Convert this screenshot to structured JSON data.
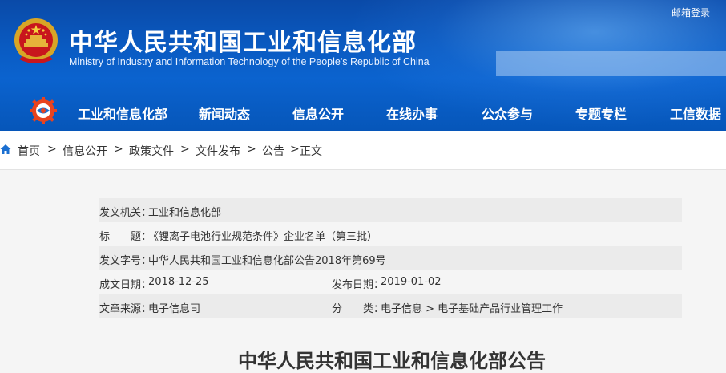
{
  "header": {
    "site_title": "中华人民共和国工业和信息化部",
    "site_subtitle": "Ministry of Industry and Information Technology of the People's Republic of China",
    "login_link": "邮箱登录",
    "search_placeholder": ""
  },
  "nav": {
    "items": [
      "工业和信息化部",
      "新闻动态",
      "信息公开",
      "在线办事",
      "公众参与",
      "专题专栏",
      "工信数据"
    ]
  },
  "breadcrumb": {
    "items": [
      "首页",
      "信息公开",
      "政策文件",
      "文件发布",
      "公告",
      "正文"
    ],
    "separator": ">"
  },
  "meta": {
    "issuer_label": "发文机关：",
    "issuer_value": "工业和信息化部",
    "title_label": "标　　题：",
    "title_value": "《锂离子电池行业规范条件》企业名单（第三批）",
    "doc_no_label": "发文字号：",
    "doc_no_value": "中华人民共和国工业和信息化部公告2018年第69号",
    "created_label": "成文日期：",
    "created_value": "2018-12-25",
    "published_label": "发布日期：",
    "published_value": "2019-01-02",
    "source_label": "文章来源：",
    "source_value": "电子信息司",
    "category_label": "分　　类：",
    "category_value": "电子信息 > 电子基础产品行业管理工作"
  },
  "document": {
    "heading": "中华人民共和国工业和信息化部公告"
  },
  "colors": {
    "header_blue": "#0a5cc4",
    "row_shade": "#ebebeb",
    "content_bg": "#f5f5f5"
  }
}
